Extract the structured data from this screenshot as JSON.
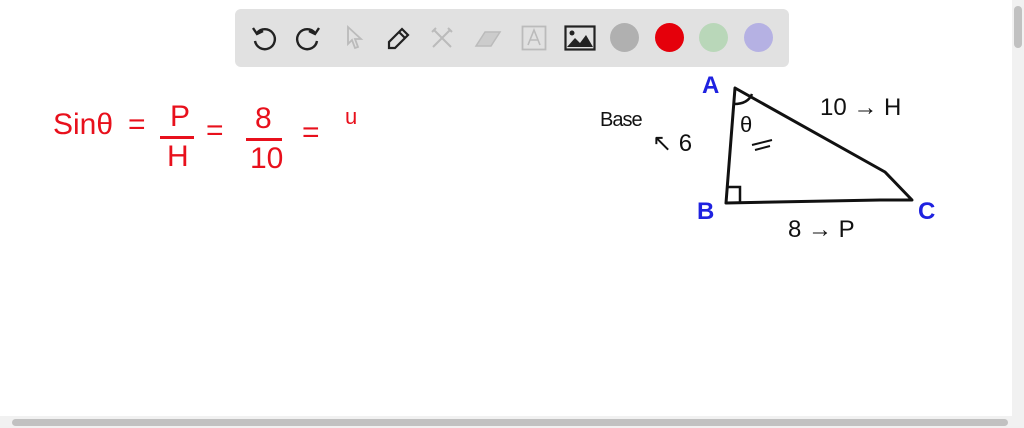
{
  "toolbar": {
    "tools": [
      "undo-icon",
      "redo-icon",
      "select-icon",
      "pen-icon",
      "tools-icon",
      "eraser-icon",
      "text-icon",
      "image-icon"
    ],
    "colors": [
      "#b0b0b0",
      "#e5000b",
      "#b9d7b9",
      "#b5b1e3"
    ]
  },
  "equation": {
    "lhs": "Sinθ",
    "eq1": "=",
    "num1": "P",
    "den1": "H",
    "eq2": "=",
    "num2": "8",
    "den2": "10",
    "eq3": "=",
    "partial": "u"
  },
  "triangle": {
    "vertex_a": "A",
    "vertex_b": "B",
    "vertex_c": "C",
    "angle": "θ",
    "hyp_label": "10 → H",
    "base_word": "Base",
    "base_label": "↖ 6",
    "perp_label": "8 → P"
  }
}
